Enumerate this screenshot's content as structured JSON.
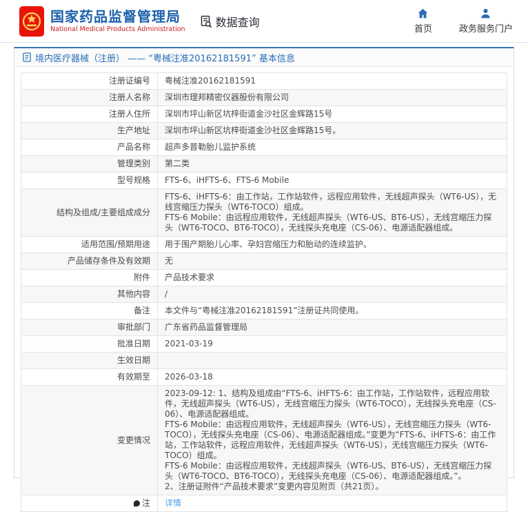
{
  "header": {
    "org_name_cn": "国家药品监督管理局",
    "org_name_en": "National Medical Products Administration",
    "section_label": "数据查询",
    "nav": [
      {
        "label": "首页",
        "icon": "home-icon"
      },
      {
        "label": "政务服务门户",
        "icon": "user-icon"
      }
    ]
  },
  "page": {
    "title": "境内医疗器械（注册） —— “粤械注准20162181591” 基本信息"
  },
  "table": {
    "rows": [
      {
        "label": "注册证编号",
        "value": "粤械注准20162181591"
      },
      {
        "label": "注册人名称",
        "value": "深圳市理邦精密仪器股份有限公司"
      },
      {
        "label": "注册人住所",
        "value": "深圳市坪山新区坑梓街道金沙社区金辉路15号"
      },
      {
        "label": "生产地址",
        "value": "深圳市坪山新区坑梓街道金沙社区金辉路15号。"
      },
      {
        "label": "产品名称",
        "value": "超声多普勒胎儿监护系统"
      },
      {
        "label": "管理类别",
        "value": "第二类"
      },
      {
        "label": "型号规格",
        "value": "FTS-6、iHFTS-6、FTS-6 Mobile"
      },
      {
        "label": "结构及组成/主要组成成分",
        "value": "FTS-6、iHFTS-6：由工作站，工作站软件，远程应用软件，无线超声探头（WT6-US），无线宫缩压力探头（WT6-TOCO）组成。\nFTS-6 Mobile：由远程应用软件，无线超声探头（WT6-US、BT6-US），无线宫缩压力探头（WT6-TOCO、BT6-TOCO），无线探头充电座（CS-06）、电源适配器组成。"
      },
      {
        "label": "适用范围/预期用途",
        "value": "用于围产期胎儿心率、孕妇宫缩压力和胎动的连续监护。"
      },
      {
        "label": "产品储存条件及有效期",
        "value": "无"
      },
      {
        "label": "附件",
        "value": "产品技术要求"
      },
      {
        "label": "其他内容",
        "value": "/"
      },
      {
        "label": "备注",
        "value": "本文件与“粤械注准20162181591”注册证共同使用。"
      },
      {
        "label": "审批部门",
        "value": "广东省药品监督管理局"
      },
      {
        "label": "批准日期",
        "value": "2021-03-19"
      },
      {
        "label": "生效日期",
        "value": ""
      },
      {
        "label": "有效期至",
        "value": "2026-03-18"
      },
      {
        "label": "变更情况",
        "value": "2023-09-12: 1、结构及组成由“FTS-6、iHFTS-6：由工作站，工作站软件，远程应用软件，无线超声探头（WT6-US），无线宫缩压力探头（WT6-TOCO），无线探头充电座（CS-06）、电源适配器组成。\nFTS-6 Mobile：由远程应用软件，无线超声探头（WT6-US），无线宫缩压力探头（WT6-TOCO），无线探头充电座（CS-06）、电源适配器组成。”变更为“FTS-6、iHFTS-6：由工作站，工作站软件，远程应用软件，无线超声探头（WT6-US），无线宫缩压力探头（WT6-TOCO）组成。\nFTS-6 Mobile：由远程应用软件，无线超声探头（WT6-US、BT6-US），无线宫缩压力探头（WT6-TOCO、BT6-TOCO），无线探头充电座（CS-06）、电源适配器组成。”。\n2、注册证附件“产品技术要求”变更内容见附页（共21页）。"
      },
      {
        "label": "注",
        "value": "详情",
        "label_icon": "note-icon",
        "value_is_link": true
      }
    ]
  },
  "colors": {
    "brand_blue": "#1c60ab",
    "brand_red": "#c3201f",
    "accent_border_blue": "#3679b5",
    "breadcrumb_blue": "#2a6db6",
    "nav_icon_blue": "#2b6cb3",
    "link_blue": "#4ba0e9",
    "logo_red": "#e8140c",
    "logo_gold": "#ffd45c",
    "row_alt_bg": "#f7f7f7",
    "table_border": "#e3e3e3"
  }
}
